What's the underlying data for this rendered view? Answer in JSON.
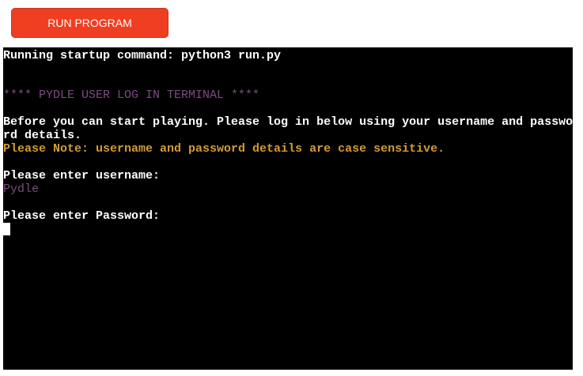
{
  "toolbar": {
    "run_label": "RUN PROGRAM",
    "run_color": "#ef3e22"
  },
  "terminal": {
    "startup": "Running startup command: python3 run.py",
    "banner": "**** PYDLE USER LOG IN TERMINAL ****",
    "intro_line1": "Before you can start playing. Please log in below using your username and passwo",
    "intro_line2": "rd details.",
    "note": "Please Note: username and password details are case sensitive.",
    "username_prompt": "Please enter username:",
    "username_value": "Pydle",
    "password_prompt": "Please enter Password:",
    "colors": {
      "background": "#000000",
      "text": "#ffffff",
      "banner": "#7d4a83",
      "note": "#d39b35"
    }
  }
}
